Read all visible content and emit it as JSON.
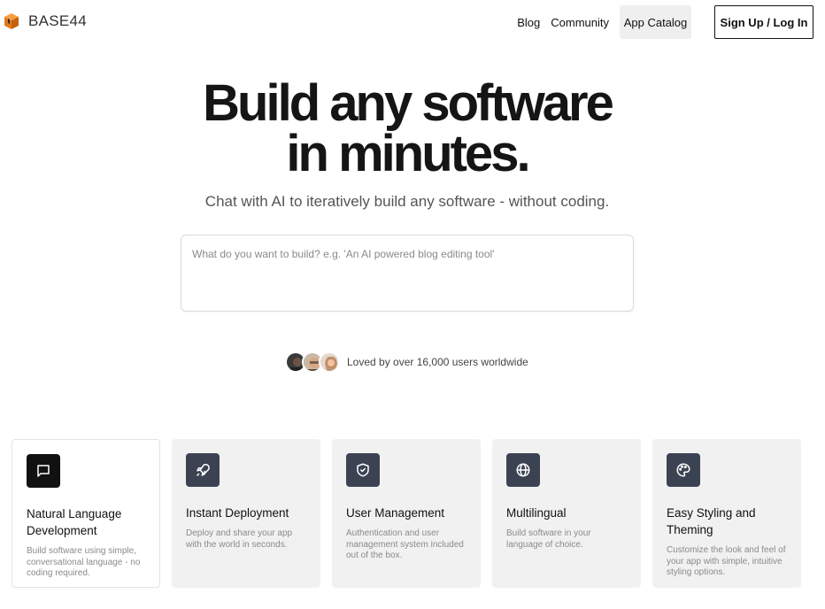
{
  "header": {
    "logo_text": "BASE44",
    "nav": {
      "blog": "Blog",
      "community": "Community",
      "app_catalog": "App Catalog",
      "signup": "Sign Up / Log In"
    }
  },
  "hero": {
    "title_line1": "Build any software",
    "title_line2": "in minutes.",
    "subtitle": "Chat with AI to iteratively build any software - without coding.",
    "prompt_placeholder": "What do you want to build? e.g. 'An AI powered blog editing tool'",
    "prompt_value": "",
    "social_proof": "Loved by over 16,000 users worldwide"
  },
  "features": [
    {
      "icon": "chat-bubble-icon",
      "title": "Natural Language Development",
      "desc": "Build software using simple, conversational language - no coding required."
    },
    {
      "icon": "rocket-icon",
      "title": "Instant Deployment",
      "desc": "Deploy and share your app with the world in seconds."
    },
    {
      "icon": "shield-check-icon",
      "title": "User Management",
      "desc": "Authentication and user management system included out of the box."
    },
    {
      "icon": "globe-icon",
      "title": "Multilingual",
      "desc": "Build software in your language of choice."
    },
    {
      "icon": "palette-icon",
      "title": "Easy Styling and Theming",
      "desc": "Customize the look and feel of your app with simple, intuitive styling options."
    }
  ],
  "colors": {
    "accent_dark": "#111111",
    "icon_bg": "#3b4353",
    "card_bg": "#f1f1f1",
    "logo_orange": "#f08a24"
  }
}
